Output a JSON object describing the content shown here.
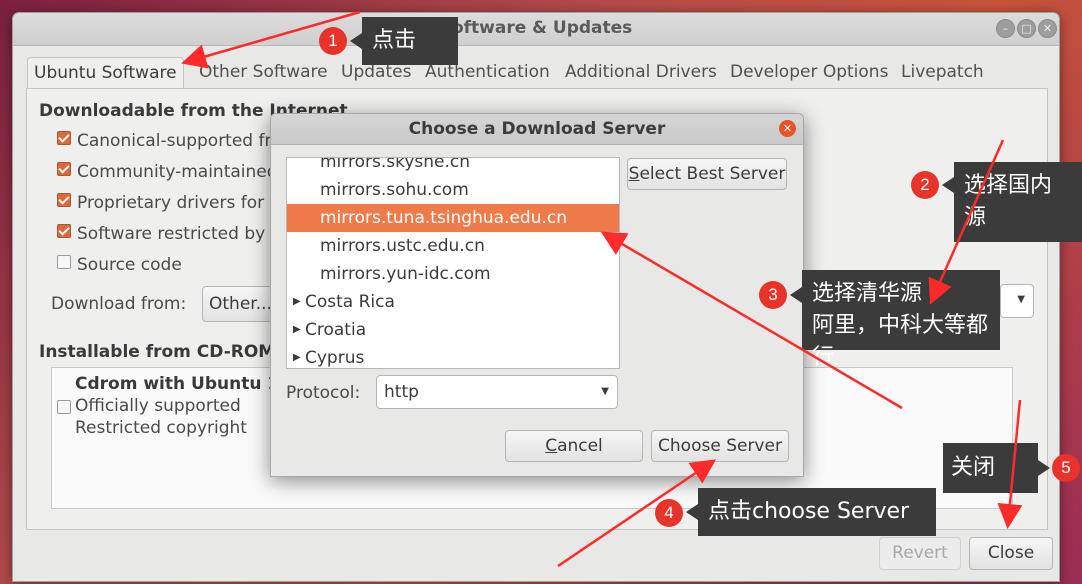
{
  "window": {
    "title": "Software & Updates",
    "controls": [
      "–",
      "□",
      "✕"
    ]
  },
  "tabs": [
    {
      "label": "Ubuntu Software",
      "active": true
    },
    {
      "label": "Other Software",
      "active": false
    },
    {
      "label": "Updates",
      "active": false
    },
    {
      "label": "Authentication",
      "active": false
    },
    {
      "label": "Additional Drivers",
      "active": false
    },
    {
      "label": "Developer Options",
      "active": false
    },
    {
      "label": "Livepatch",
      "active": false
    }
  ],
  "internet": {
    "heading": "Downloadable from the Internet",
    "items": [
      {
        "label": "Canonical-supported fre",
        "checked": true
      },
      {
        "label": "Community-maintained",
        "checked": true
      },
      {
        "label": "Proprietary drivers for d",
        "checked": true
      },
      {
        "label": "Software restricted by c",
        "checked": true
      },
      {
        "label": "Source code",
        "checked": false
      }
    ],
    "download_from_label": "Download from:",
    "download_from_value": "Other..."
  },
  "cdrom": {
    "heading": "Installable from CD-ROM/D",
    "title": "Cdrom with Ubuntu 18.",
    "line1": "Officially supported",
    "line2": "Restricted copyright",
    "checked": false
  },
  "footer": {
    "revert_label": "Revert",
    "close_label": "Close"
  },
  "dialog": {
    "title": "Choose a Download Server",
    "close_glyph": "✕",
    "servers": [
      {
        "label": "mirrors.skyshe.cn",
        "selected": false,
        "kind": "server"
      },
      {
        "label": "mirrors.sohu.com",
        "selected": false,
        "kind": "server"
      },
      {
        "label": "mirrors.tuna.tsinghua.edu.cn",
        "selected": true,
        "kind": "server"
      },
      {
        "label": "mirrors.ustc.edu.cn",
        "selected": false,
        "kind": "server"
      },
      {
        "label": "mirrors.yun-idc.com",
        "selected": false,
        "kind": "server"
      },
      {
        "label": "Costa Rica",
        "selected": false,
        "kind": "country"
      },
      {
        "label": "Croatia",
        "selected": false,
        "kind": "country"
      },
      {
        "label": "Cyprus",
        "selected": false,
        "kind": "country"
      }
    ],
    "select_best_label": "Select Best Server",
    "protocol_label": "Protocol:",
    "protocol_value": "http",
    "cancel_label": "Cancel",
    "choose_label": "Choose Server"
  },
  "annotations": [
    {
      "num": "1",
      "text": "点击"
    },
    {
      "num": "2",
      "text_line1": "选择国内",
      "text_line2": "源"
    },
    {
      "num": "3",
      "text_line1": "选择清华源",
      "text_line2": "阿里，中科大等都行"
    },
    {
      "num": "4",
      "text": "点击choose Server"
    },
    {
      "num": "5",
      "text": "关闭"
    }
  ],
  "colors": {
    "accent": "#ef7b4a",
    "badge": "#e8332a",
    "callout_bg": "#3b3b3b",
    "arrow": "#ff2a2a"
  }
}
